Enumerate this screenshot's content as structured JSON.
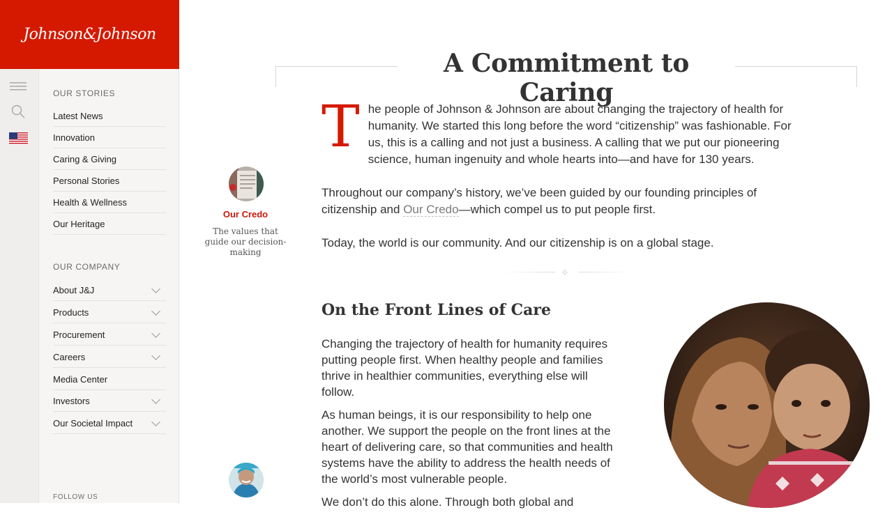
{
  "brand": {
    "logo_text": "Johnson&Johnson",
    "accent": "#d51900"
  },
  "sidebar": {
    "rail": {
      "menu_icon": "hamburger-menu-icon",
      "search_icon": "search-icon",
      "flag_icon": "us-flag-icon"
    },
    "our_stories": {
      "title": "OUR STORIES",
      "items": [
        {
          "label": "Latest News"
        },
        {
          "label": "Innovation"
        },
        {
          "label": "Caring & Giving"
        },
        {
          "label": "Personal Stories"
        },
        {
          "label": "Health & Wellness"
        },
        {
          "label": "Our Heritage"
        }
      ]
    },
    "our_company": {
      "title": "OUR COMPANY",
      "items": [
        {
          "label": "About J&J",
          "expandable": true
        },
        {
          "label": "Products",
          "expandable": true
        },
        {
          "label": "Procurement",
          "expandable": true
        },
        {
          "label": "Careers",
          "expandable": true
        },
        {
          "label": "Media Center",
          "expandable": false
        },
        {
          "label": "Investors",
          "expandable": true
        },
        {
          "label": "Our Societal Impact",
          "expandable": true
        }
      ]
    },
    "follow_label": "FOLLOW US"
  },
  "main": {
    "title": "A Commitment to Caring",
    "intro": {
      "drop_cap": "T",
      "p1": "he people of Johnson & Johnson are about changing the trajectory of health for humanity. We started this long before the word “citizenship” was fashionable. For us, this is a calling and not just a business. A calling that we put our pioneering science, human ingenuity and whole hearts into—and have for 130 years.",
      "p2_before": "Throughout our company’s history, we’ve been guided by our founding principles of citizenship and ",
      "p2_link": "Our Credo",
      "p2_after": "—which compel us to put people first.",
      "p3": "Today, the world is our community. And our citizenship is on a global stage."
    },
    "credo_card": {
      "link_label": "Our Credo",
      "description": "The values that guide our decision-making"
    },
    "section": {
      "heading": "On the Front Lines of Care",
      "p1": "Changing the trajectory of health for humanity requires putting people first. When healthy people and families thrive in healthier communities, everything else will follow.",
      "p2": "As human beings, it is our responsibility to help one another. We support the people on the front lines at the heart of delivering care, so that communities and health systems have the ability to address the health needs of the world’s most vulnerable people.",
      "p3": "We don’t do this alone. Through both global and"
    }
  }
}
